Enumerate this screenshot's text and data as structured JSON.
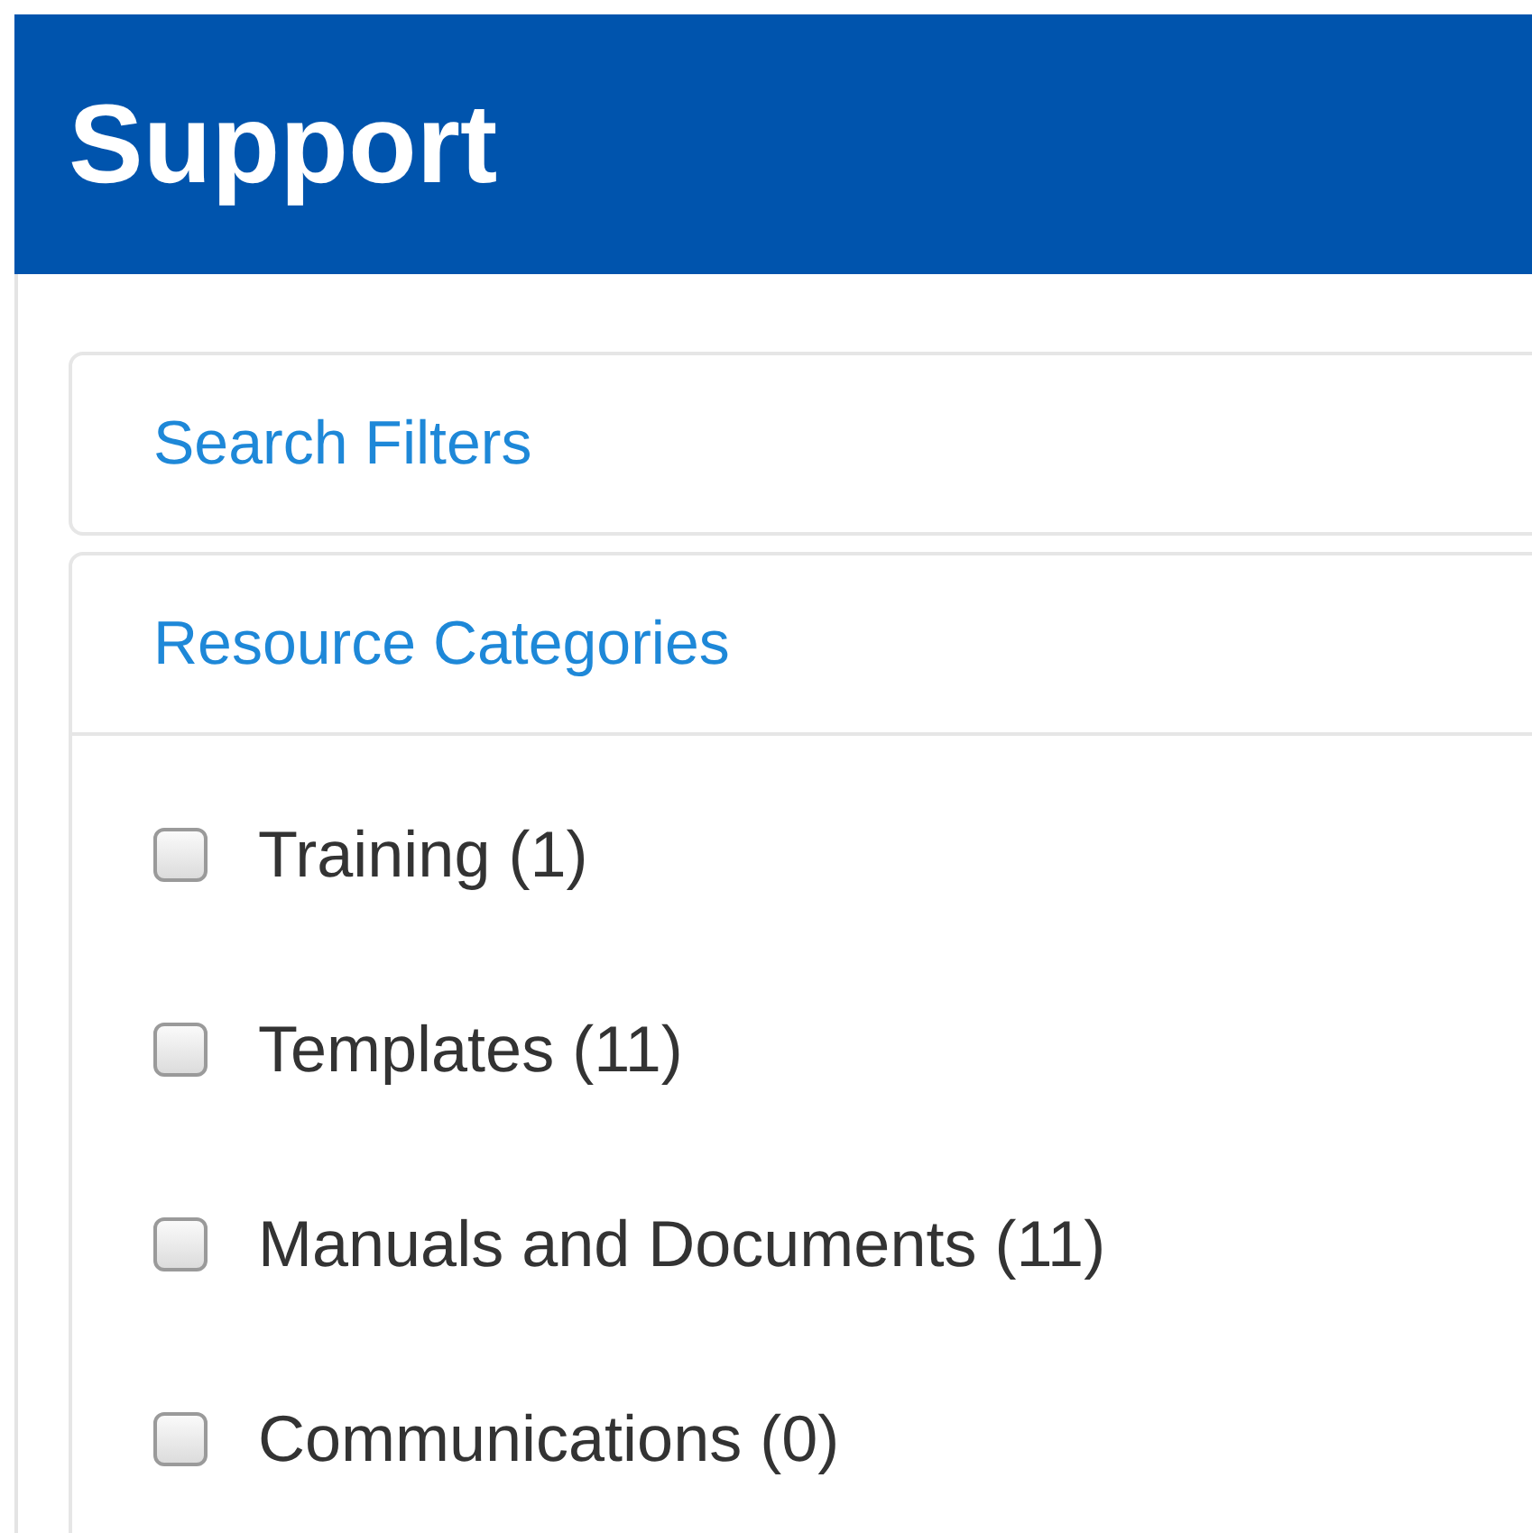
{
  "header": {
    "title": "Support"
  },
  "panels": [
    {
      "title": "Search Filters",
      "kind": "collapsed"
    },
    {
      "title": "Resource Categories",
      "kind": "expanded",
      "items": [
        {
          "label": "Training (1)",
          "checked": false
        },
        {
          "label": "Templates (11)",
          "checked": false
        },
        {
          "label": "Manuals and Documents (11)",
          "checked": false
        },
        {
          "label": "Communications (0)",
          "checked": false
        }
      ]
    }
  ]
}
